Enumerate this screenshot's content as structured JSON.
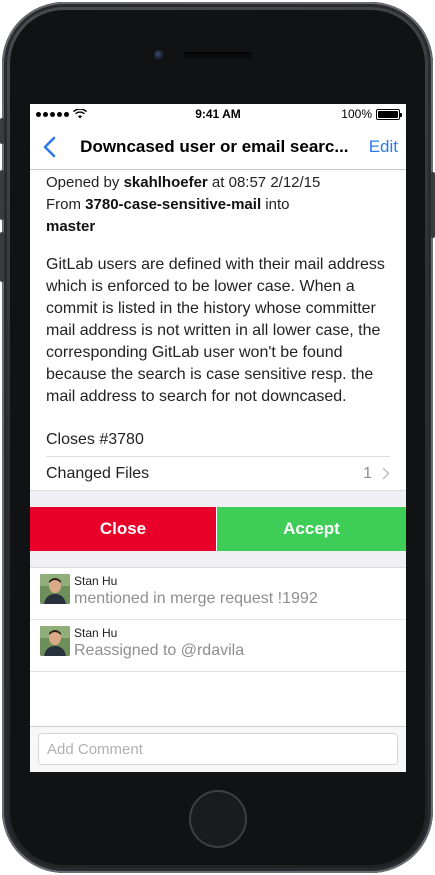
{
  "status_bar": {
    "time": "9:41 AM",
    "battery": "100%"
  },
  "nav": {
    "title": "Downcased user or email searc...",
    "edit_label": "Edit"
  },
  "merge_request": {
    "opened_prefix": "Opened by ",
    "author": "skahlhoefer",
    "opened_at": " at 08:57 2/12/15",
    "from_prefix": "From ",
    "source_branch": "3780-case-sensitive-mail",
    "into_label": " into",
    "target_branch": "master",
    "description": "GitLab users are defined with their mail address which is enforced to be lower case. When a commit is listed in the history whose committer mail address is not written in all lower case, the corresponding GitLab user won't be found because the search is case sensitive resp. the mail address to search for not downcased.",
    "closes": "Closes #3780",
    "changed_files_label": "Changed Files",
    "changed_files_count": "1"
  },
  "actions": {
    "close_label": "Close",
    "accept_label": "Accept"
  },
  "notes": [
    {
      "author": "Stan Hu",
      "text": "mentioned in merge request !1992"
    },
    {
      "author": "Stan Hu",
      "text": "Reassigned to @rdavila"
    }
  ],
  "comment": {
    "placeholder": "Add Comment"
  },
  "colors": {
    "accent": "#2d7ae8",
    "close": "#e8002b",
    "accept": "#3ece58"
  }
}
